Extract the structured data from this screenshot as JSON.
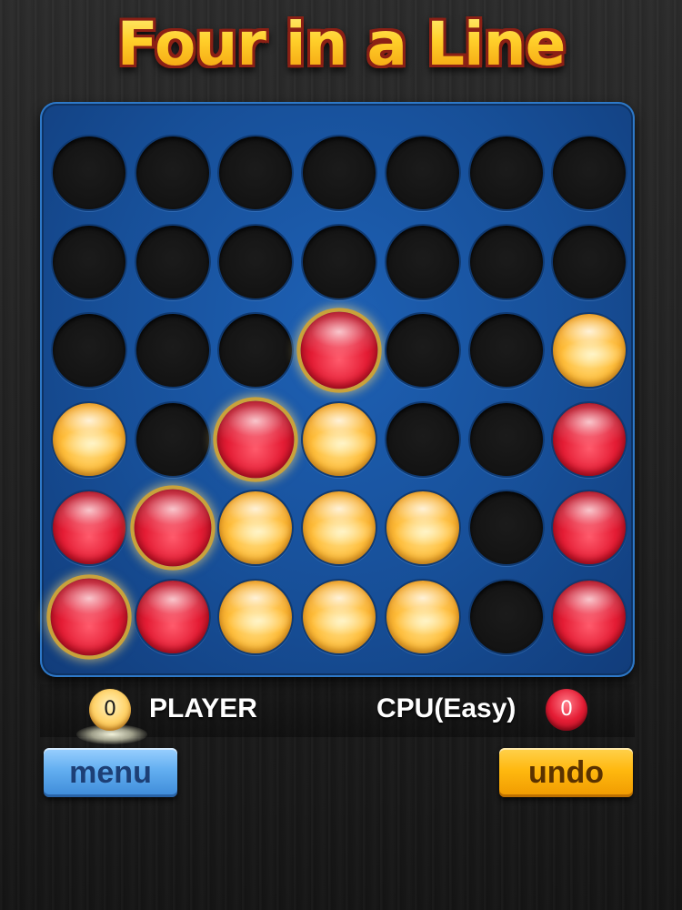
{
  "title": "Four in a Line",
  "board": {
    "rows": 6,
    "columns": 7,
    "cells": [
      [
        "empty",
        "empty",
        "empty",
        "empty",
        "empty",
        "empty",
        "empty"
      ],
      [
        "empty",
        "empty",
        "empty",
        "empty",
        "empty",
        "empty",
        "empty"
      ],
      [
        "empty",
        "empty",
        "empty",
        "red",
        "empty",
        "empty",
        "yellow"
      ],
      [
        "yellow",
        "empty",
        "red",
        "yellow",
        "empty",
        "empty",
        "red"
      ],
      [
        "red",
        "red",
        "yellow",
        "yellow",
        "yellow",
        "empty",
        "red"
      ],
      [
        "red",
        "red",
        "yellow",
        "yellow",
        "yellow",
        "empty",
        "red"
      ]
    ],
    "winning_cells": [
      [
        2,
        3
      ],
      [
        3,
        2
      ],
      [
        4,
        1
      ],
      [
        5,
        0
      ]
    ]
  },
  "player": {
    "name": "PLAYER",
    "score": "0",
    "color": "yellow"
  },
  "cpu": {
    "name": "CPU(Easy)",
    "score": "0",
    "color": "red"
  },
  "buttons": {
    "menu": "menu",
    "undo": "undo"
  },
  "colors": {
    "board": "#174f98",
    "red_piece": "#e51d35",
    "yellow_piece": "#ffbe3a",
    "menu_button": "#62aef0",
    "undo_button": "#ffb80f",
    "title": "#ffc21e"
  }
}
